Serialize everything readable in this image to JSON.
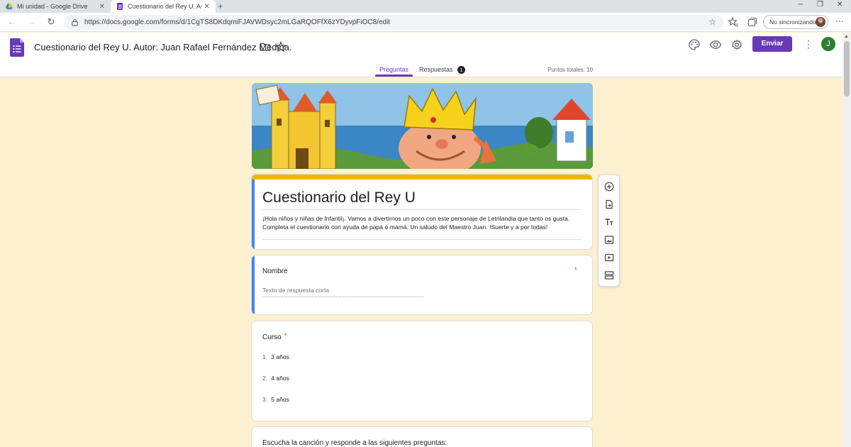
{
  "browser": {
    "tabs": [
      {
        "title": "Mi unidad - Google Drive",
        "active": false
      },
      {
        "title": "Cuestionario del Rey U. Autor: Ju",
        "active": true
      }
    ],
    "url": "https://docs.google.com/forms/d/1CgTS8DKdqmiFJAVWDsyc2mLGaRQOFfX6zYDyvpFiOC8/edit",
    "sync_label": "No sincronizando"
  },
  "header": {
    "doc_title": "Cuestionario del Rey U.  Autor: Juan Rafael Fernández Medina.",
    "send_label": "Enviar",
    "avatar_letter": "J"
  },
  "tabs": {
    "questions": "Preguntas",
    "responses": "Respuestas",
    "responses_count": "1",
    "points": "Puntos totales: 10"
  },
  "form": {
    "title": "Cuestionario del Rey U",
    "description": "¡Hola niños y niñas de Infantil¡. Vamos a divertirnos un poco con este personaje de Letrilandia que tanto os gusta. Completa el cuestionario con ayuda de papá o mamá. Un saludo del Maestro Juan. !Suerte y a por todas!"
  },
  "questions": [
    {
      "label": "Nombre",
      "required_mark": "*",
      "placeholder": "Texto de respuesta corta"
    },
    {
      "label": "Curso",
      "required_mark": "*",
      "options": [
        {
          "num": "1.",
          "text": "3 años"
        },
        {
          "num": "2.",
          "text": "4 años"
        },
        {
          "num": "3.",
          "text": "5 años"
        }
      ]
    },
    {
      "label": "Escucha la canción y responde a las siguientes preguntas:"
    }
  ],
  "colors": {
    "theme": "#673ab7",
    "background": "#fdf1cf",
    "title_bar": "#f4b400",
    "selected_edge": "#4285f4"
  }
}
